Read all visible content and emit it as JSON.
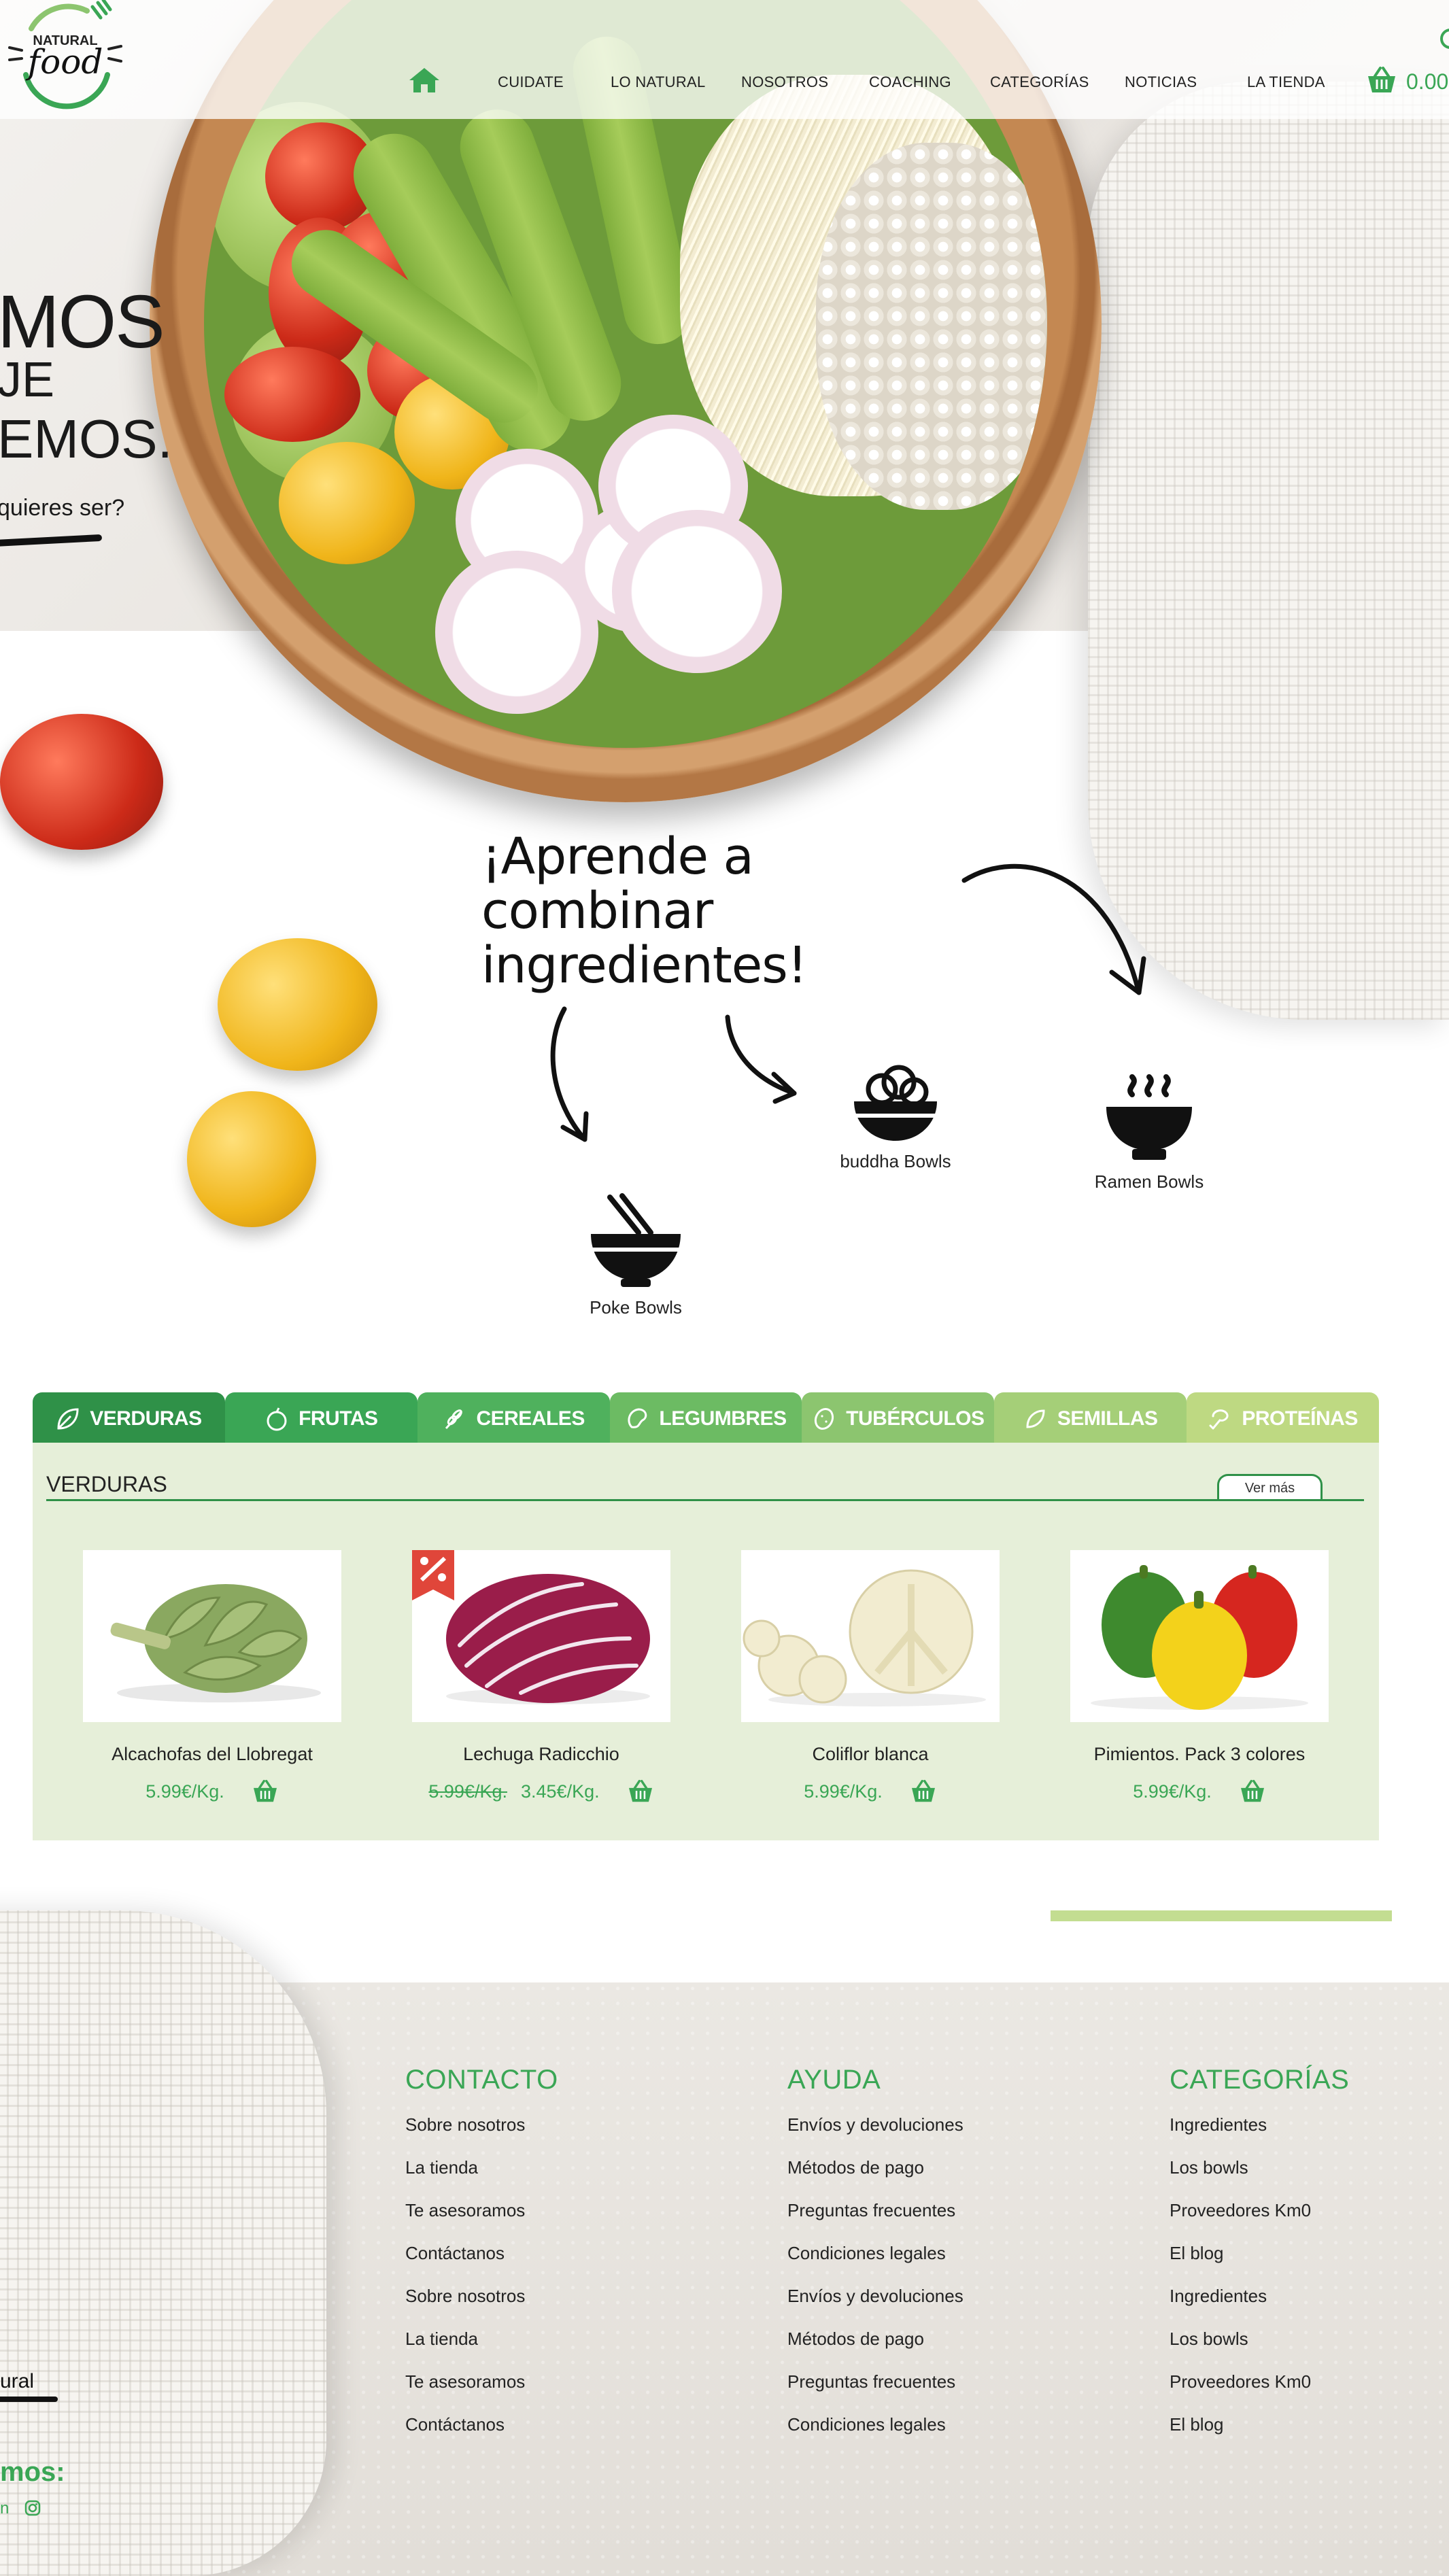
{
  "header": {
    "nav": [
      "CUIDATE",
      "LO NATURAL",
      "NOSOTROS",
      "COACHING",
      "CATEGORÍAS",
      "NOTICIAS",
      "LA TIENDA"
    ],
    "cart_total": "0.00",
    "logo_text_top": "NATURAL",
    "logo_text_main": "food"
  },
  "hero": {
    "line1": "MOS",
    "line2": "JE",
    "line3": "EMOS.",
    "question": "quieres ser?"
  },
  "learn": {
    "title": "¡Aprende a combinar ingredientes!",
    "bowls": [
      {
        "label": "buddha Bowls",
        "icon": "buddha-bowl-icon"
      },
      {
        "label": "Ramen Bowls",
        "icon": "ramen-bowl-icon"
      },
      {
        "label": "Poke Bowls",
        "icon": "poke-bowl-icon"
      }
    ]
  },
  "products_section": {
    "tabs": [
      {
        "label": "VERDURAS",
        "color": "#2f9148",
        "icon": "leaf-icon"
      },
      {
        "label": "FRUTAS",
        "color": "#3aa655",
        "icon": "apple-icon"
      },
      {
        "label": "CEREALES",
        "color": "#4fb15d",
        "icon": "wheat-icon"
      },
      {
        "label": "LEGUMBRES",
        "color": "#6cbb63",
        "icon": "bean-icon"
      },
      {
        "label": "TUBÉRCULOS",
        "color": "#8cc56f",
        "icon": "potato-icon"
      },
      {
        "label": "SEMILLAS",
        "color": "#a5cf78",
        "icon": "seed-icon"
      },
      {
        "label": "PROTEÍNAS",
        "color": "#bed982",
        "icon": "protein-icon"
      }
    ],
    "title": "VERDURAS",
    "ver_mas": "Ver más",
    "products": [
      {
        "name": "Alcachofas del Llobregat",
        "price": "5.99€/Kg.",
        "old_price": ""
      },
      {
        "name": "Lechuga Radicchio",
        "price": "3.45€/Kg.",
        "old_price": "5.99€/Kg."
      },
      {
        "name": "Coliflor blanca",
        "price": "5.99€/Kg.",
        "old_price": ""
      },
      {
        "name": "Pimientos. Pack 3 colores",
        "price": "5.99€/Kg.",
        "old_price": ""
      }
    ]
  },
  "footer": {
    "columns": [
      {
        "title": "CONTACTO",
        "links": [
          "Sobre nosotros",
          "La tienda",
          "Te asesoramos",
          "Contáctanos",
          "Sobre nosotros",
          "La tienda",
          "Te asesoramos",
          "Contáctanos"
        ]
      },
      {
        "title": "AYUDA",
        "links": [
          "Envíos y devoluciones",
          "Métodos de pago",
          "Preguntas frecuentes",
          "Condiciones legales",
          "Envíos y devoluciones",
          "Métodos de pago",
          "Preguntas frecuentes",
          "Condiciones legales"
        ]
      },
      {
        "title": "CATEGORÍAS",
        "links": [
          "Ingredientes",
          "Los bowls",
          "Proveedores Km0",
          "El blog",
          "Ingredientes",
          "Los bowls",
          "Proveedores Km0",
          "El blog"
        ]
      }
    ],
    "natural_partial": "ural",
    "follow_partial": "mos:",
    "social_partial": "n"
  }
}
